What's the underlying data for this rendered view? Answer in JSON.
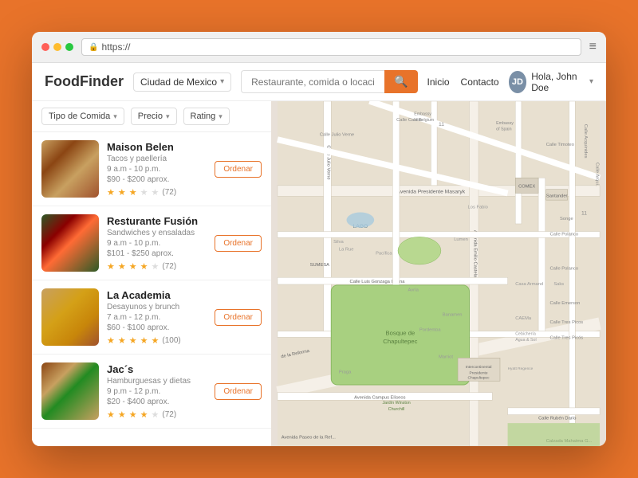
{
  "browser": {
    "url": "https://",
    "menu_icon": "≡"
  },
  "header": {
    "logo_food": "Food",
    "logo_finder": "Finder",
    "location": "Ciudad de Mexico",
    "search_placeholder": "Restaurante, comida o locación...",
    "search_icon": "🔍",
    "nav_inicio": "Inicio",
    "nav_contacto": "Contacto",
    "user_name": "Hola, John Doe",
    "user_initials": "JD"
  },
  "filters": {
    "tipo": "Tipo de Comida",
    "precio": "Precio",
    "rating": "Rating"
  },
  "restaurants": [
    {
      "name": "Maison Belen",
      "type": "Tacos y paellería",
      "hours": "9 a.m - 10 p.m.",
      "price": "$90 - $200 aprox.",
      "stars": 3,
      "max_stars": 5,
      "rating_count": "(72)",
      "order_label": "Ordenar",
      "img_class": "img-tacos"
    },
    {
      "name": "Resturante Fusión",
      "type": "Sandwiches y ensaladas",
      "hours": "9 a.m - 10 p.m.",
      "price": "$101 - $250 aprox.",
      "stars": 4,
      "max_stars": 5,
      "rating_count": "(72)",
      "order_label": "Ordenar",
      "img_class": "img-salad"
    },
    {
      "name": "La Academia",
      "type": "Desayunos y brunch",
      "hours": "7 a.m - 12 p.m.",
      "price": "$60 - $100 aprox.",
      "stars": 5,
      "max_stars": 5,
      "rating_count": "(100)",
      "order_label": "Ordenar",
      "img_class": "img-pancakes"
    },
    {
      "name": "Jac´s",
      "type": "Hamburguesas y dietas",
      "hours": "9 p.m - 12 p.m.",
      "price": "$20 - $400 aprox.",
      "stars": 4,
      "max_stars": 5,
      "rating_count": "(72)",
      "order_label": "Ordenar",
      "img_class": "img-burger"
    }
  ],
  "colors": {
    "accent": "#E8732A",
    "star_filled": "#f5a623",
    "star_empty": "#ddd"
  }
}
